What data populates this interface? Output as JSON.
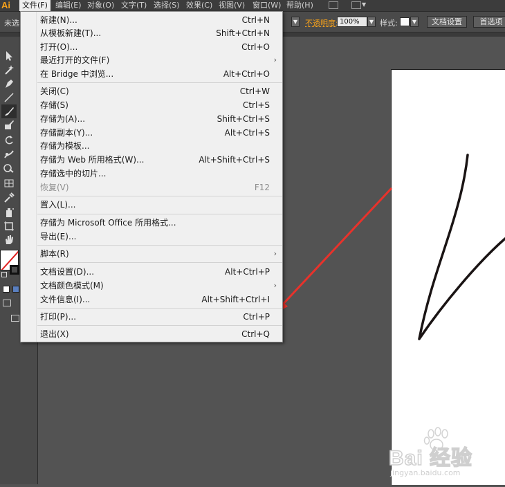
{
  "app": {
    "logo_text": "Ai",
    "logo_color": "#f7a21b"
  },
  "menubar": {
    "items": [
      {
        "label": "文件(F)"
      },
      {
        "label": "编辑(E)"
      },
      {
        "label": "对象(O)"
      },
      {
        "label": "文字(T)"
      },
      {
        "label": "选择(S)"
      },
      {
        "label": "效果(C)"
      },
      {
        "label": "视图(V)"
      },
      {
        "label": "窗口(W)"
      },
      {
        "label": "帮助(H)"
      }
    ]
  },
  "controlbar": {
    "left_label": "未选",
    "opacity_label": "不透明度:",
    "opacity_value": "100%",
    "style_label": "样式:",
    "doc_settings_button": "文档设置",
    "preferences_button": "首选项"
  },
  "file_menu": {
    "items": [
      {
        "label": "新建(N)...",
        "shortcut": "Ctrl+N"
      },
      {
        "label": "从模板新建(T)...",
        "shortcut": "Shift+Ctrl+N"
      },
      {
        "label": "打开(O)...",
        "shortcut": "Ctrl+O"
      },
      {
        "label": "最近打开的文件(F)",
        "shortcut": "",
        "submenu": "›"
      },
      {
        "label": "在 Bridge 中浏览...",
        "shortcut": "Alt+Ctrl+O"
      },
      {
        "label": "关闭(C)",
        "shortcut": "Ctrl+W"
      },
      {
        "label": "存储(S)",
        "shortcut": "Ctrl+S"
      },
      {
        "label": "存储为(A)...",
        "shortcut": "Shift+Ctrl+S"
      },
      {
        "label": "存储副本(Y)...",
        "shortcut": "Alt+Ctrl+S"
      },
      {
        "label": "存储为模板...",
        "shortcut": ""
      },
      {
        "label": "存储为 Web 所用格式(W)...",
        "shortcut": "Alt+Shift+Ctrl+S"
      },
      {
        "label": "存储选中的切片...",
        "shortcut": ""
      },
      {
        "label": "恢复(V)",
        "shortcut": "F12",
        "disabled": true
      },
      {
        "label": "置入(L)...",
        "shortcut": ""
      },
      {
        "label": "存储为 Microsoft Office 所用格式...",
        "shortcut": ""
      },
      {
        "label": "导出(E)...",
        "shortcut": ""
      },
      {
        "label": "脚本(R)",
        "shortcut": "",
        "submenu": "›"
      },
      {
        "label": "文档设置(D)...",
        "shortcut": "Alt+Ctrl+P"
      },
      {
        "label": "文档颜色模式(M)",
        "shortcut": "",
        "submenu": "›"
      },
      {
        "label": "文件信息(I)...",
        "shortcut": "Alt+Shift+Ctrl+I"
      },
      {
        "label": "打印(P)...",
        "shortcut": "Ctrl+P"
      },
      {
        "label": "退出(X)",
        "shortcut": "Ctrl+Q"
      }
    ]
  },
  "annotation": {
    "arrow_color": "#e8322b"
  },
  "watermark": {
    "text": "Bai 经验",
    "subtext": "jingyan.baidu.com"
  },
  "tools": [
    {
      "icon": "selection-tool-icon"
    },
    {
      "icon": "magic-wand-tool-icon"
    },
    {
      "icon": "pen-tool-icon"
    },
    {
      "icon": "line-tool-icon"
    },
    {
      "icon": "paintbrush-tool-icon"
    },
    {
      "icon": "blob-brush-tool-icon"
    },
    {
      "icon": "rotate-tool-icon"
    },
    {
      "icon": "warp-tool-icon"
    },
    {
      "icon": "shape-builder-tool-icon"
    },
    {
      "icon": "perspective-grid-tool-icon"
    },
    {
      "icon": "eyedropper-tool-icon"
    },
    {
      "icon": "symbol-sprayer-tool-icon"
    },
    {
      "icon": "artboard-tool-icon"
    },
    {
      "icon": "hand-tool-icon"
    }
  ]
}
